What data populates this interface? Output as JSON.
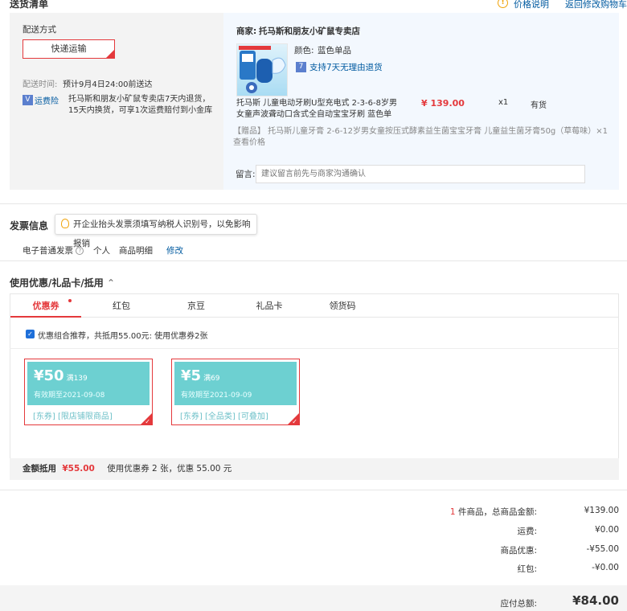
{
  "header": {
    "title": "送货清单",
    "price_note": "价格说明",
    "back_to_cart": "返回修改购物车"
  },
  "shipping": {
    "method_label": "配送方式",
    "method_value": "快递运输",
    "time_label": "配送时间:",
    "time_value": "预计9月4日24:00前送达",
    "insurance_link": "运费险",
    "insurance_text": "托马斯和朋友小矿鼠专卖店7天内退货，15天内换货，可享1次运费赔付到小金库"
  },
  "store": {
    "label": "商家:",
    "name": "托马斯和朋友小矿鼠专卖店"
  },
  "product": {
    "color_label": "颜色:",
    "color_value": "蓝色单品",
    "return_policy": "支持7天无理由退货",
    "name": "托马斯 儿童电动牙刷U型充电式 2-3-6-8岁男女童声波聋动口含式全自动宝宝牙刷 蓝色单",
    "price": "¥ 139.00",
    "qty": "x1",
    "stock": "有货",
    "gift": "【赠品】 托马斯儿童牙膏 2-6-12岁男女童按压式酵素益生菌宝宝牙膏 儿童益生菌牙膏50g（草莓味）×1  查看价格",
    "message_label": "留言:",
    "message_placeholder": "建议留言前先与商家沟通确认"
  },
  "invoice": {
    "title": "发票信息",
    "tip": "开企业抬头发票须填写纳税人识别号，以免影响报销",
    "type": "电子普通发票",
    "holder": "个人",
    "content": "商品明细",
    "edit": "修改"
  },
  "coupons": {
    "title": "使用优惠/礼品卡/抵用",
    "tabs": [
      "优惠券",
      "红包",
      "京豆",
      "礼品卡",
      "领货码"
    ],
    "recommend": "优惠组合推荐，共抵用55.00元: 使用优惠券2张",
    "items": [
      {
        "amount": "¥50",
        "threshold": "满139",
        "expire": "有效期至2021-09-08",
        "tags": "[东券]  [限店铺限商品]"
      },
      {
        "amount": "¥5",
        "threshold": "满69",
        "expire": "有效期至2021-09-09",
        "tags": "[东券]  [全品类]  [可叠加]"
      }
    ],
    "summary_label": "金额抵用",
    "summary_amount": "¥55.00",
    "summary_detail": "使用优惠券 2 张，优惠 55.00 元"
  },
  "totals": {
    "count": "1",
    "count_suffix": "件商品，总商品金额:",
    "goods_value": "¥139.00",
    "freight_label": "运费:",
    "freight_value": "¥0.00",
    "discount_label": "商品优惠:",
    "discount_value": "-¥55.00",
    "redpacket_label": "红包:",
    "redpacket_value": "-¥0.00",
    "grand_label": "应付总额:",
    "grand_value": "¥84.00"
  },
  "colors": {
    "accent": "#e4393c",
    "link": "#005aa0",
    "coupon": "#6dd0d1"
  }
}
